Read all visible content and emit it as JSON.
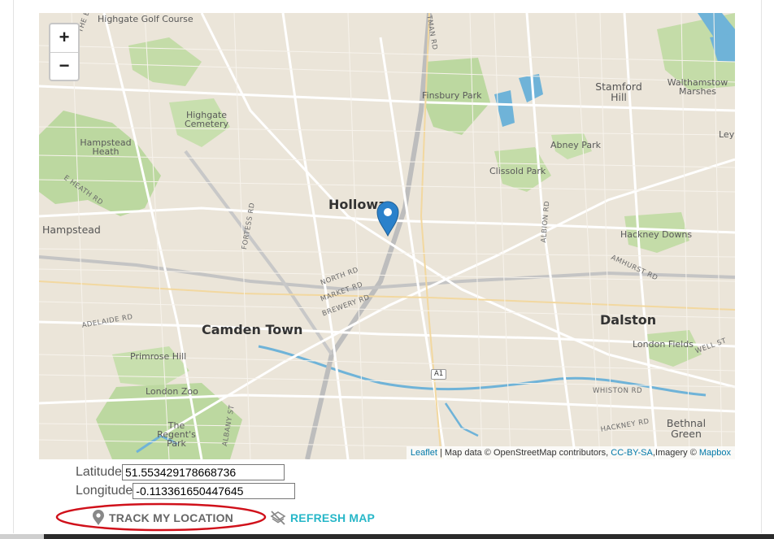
{
  "map": {
    "zoom_in": "+",
    "zoom_out": "−",
    "labels": {
      "highgate_golf": "Highgate Golf Course",
      "highgate_cemetery": "Highgate Cemetery",
      "hampstead_heath": "Hampstead Heath",
      "hampstead": "Hampstead",
      "holloway": "Hollowa",
      "finsbury_park": "Finsbury Park",
      "stamford_hill": "Stamford Hill",
      "walthamstow_marshes": "Walthamstow Marshes",
      "abney_park": "Abney Park",
      "clissold_park": "Clissold Park",
      "hackney_downs": "Hackney Downs",
      "camden_town": "Camden Town",
      "dalston": "Dalston",
      "primrose_hill": "Primrose Hill",
      "london_zoo": "London Zoo",
      "regents_park": "The Regent's Park",
      "london_fields": "London Fields",
      "bethnal_green": "Bethnal Green",
      "ley": "Ley",
      "road_bishops": "THE BISHOPS AVE",
      "road_heath": "E HEATH RD",
      "road_fortess": "FORTESS RD",
      "road_north": "NORTH RD",
      "road_market": "MARKET RD",
      "road_brewery": "BREWERY RD",
      "road_adelaide": "ADELAIDE RD",
      "road_albion": "ALBION RD",
      "road_amhurst": "AMHURST RD",
      "road_whiston": "WHISTON RD",
      "road_hackney": "HACKNEY RD",
      "road_wells": "WELL ST",
      "road_albany": "ALBANY ST",
      "road_seven_sisters": "TMAN RD",
      "road_a1": "A1"
    },
    "attribution": {
      "leaflet": "Leaflet",
      "middle": " | Map data © OpenStreetMap contributors, ",
      "license": "CC-BY-SA",
      "imagery": ",Imagery © ",
      "mapbox": "Mapbox"
    }
  },
  "form": {
    "latitude_label": "Latitude",
    "latitude_value": "51.553429178668736",
    "longitude_label": "Longitude",
    "longitude_value": "-0.113361650447645"
  },
  "actions": {
    "track_label": "TRACK MY LOCATION",
    "refresh_label": "REFRESH MAP"
  },
  "colors": {
    "accent": "#27b7c8",
    "highlight": "#d0101a",
    "marker": "#2a81cb"
  },
  "icons": {
    "track": "map-marker-icon",
    "refresh": "layers-off-icon"
  }
}
